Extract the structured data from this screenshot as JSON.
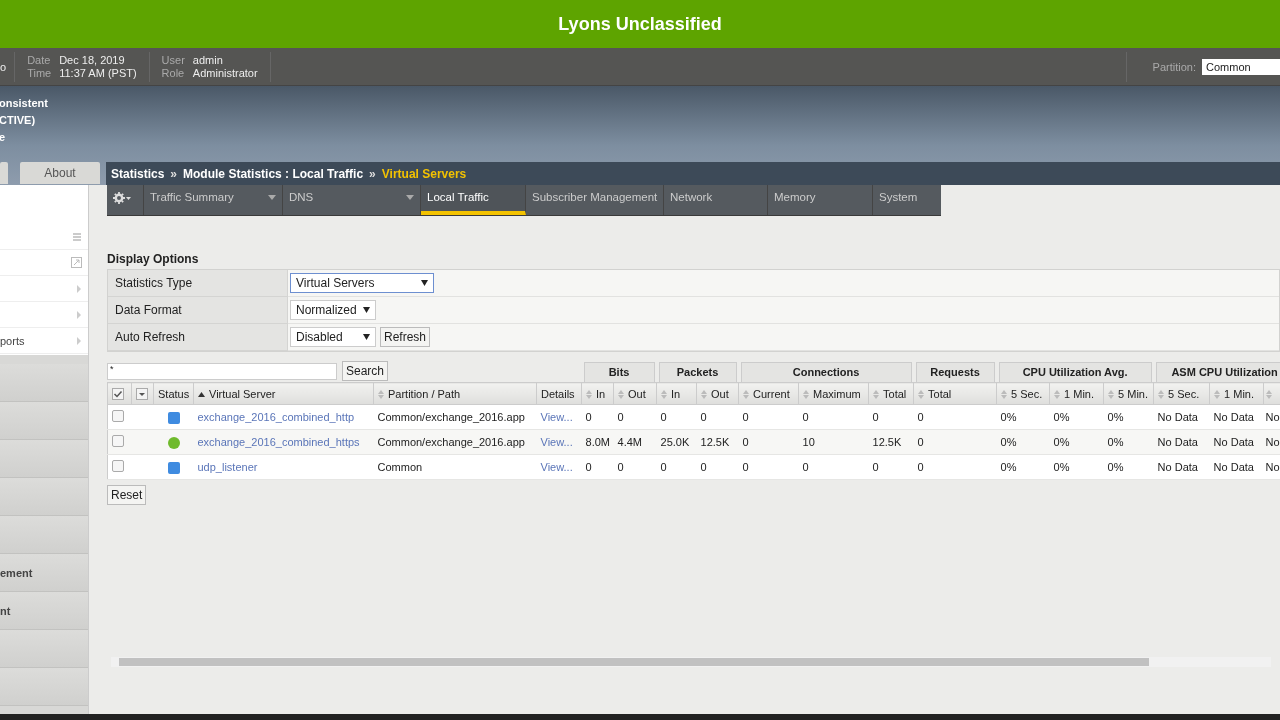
{
  "banner": {
    "title": "Lyons Unclassified"
  },
  "header": {
    "host_fragment": "o",
    "date_label": "Date",
    "date": "Dec 18, 2019",
    "time_label": "Time",
    "time": "11:37 AM (PST)",
    "user_label": "User",
    "user": "admin",
    "role_label": "Role",
    "role": "Administrator",
    "partition_label": "Partition:",
    "partition": "Common"
  },
  "status_lines": [
    "onsistent",
    "CTIVE)",
    "e"
  ],
  "top_tabs": [
    {
      "label": "About",
      "selected": false
    }
  ],
  "breadcrumb": {
    "separator": "»",
    "items": [
      {
        "text": "Statistics",
        "current": false
      },
      {
        "text": "Module Statistics : Local Traffic",
        "current": false
      },
      {
        "text": "Virtual Servers",
        "current": true
      }
    ]
  },
  "menu": {
    "items": [
      {
        "label": "Traffic Summary",
        "dropdown": true,
        "selected": false
      },
      {
        "label": "DNS",
        "dropdown": true,
        "selected": false
      },
      {
        "label": "Local Traffic",
        "dropdown": false,
        "selected": true
      },
      {
        "label": "Subscriber Management",
        "dropdown": false,
        "selected": false
      },
      {
        "label": "Network",
        "dropdown": false,
        "selected": false
      },
      {
        "label": "Memory",
        "dropdown": false,
        "selected": false
      },
      {
        "label": "System",
        "dropdown": false,
        "selected": false
      }
    ]
  },
  "sidebar": {
    "links": [
      {
        "kind": "list"
      },
      {
        "kind": "popout"
      },
      {
        "kind": "submenu"
      },
      {
        "kind": "submenu"
      },
      {
        "kind": "submenu",
        "label": "ports"
      }
    ],
    "modules": [
      {
        "label": "ement"
      },
      {
        "label": "nt"
      }
    ]
  },
  "display_options": {
    "title": "Display Options",
    "rows": [
      {
        "label": "Statistics Type",
        "value": "Virtual Servers",
        "focused": true
      },
      {
        "label": "Data Format",
        "value": "Normalized",
        "focused": false
      },
      {
        "label": "Auto Refresh",
        "value": "Disabled",
        "focused": false,
        "button": "Refresh"
      }
    ]
  },
  "search": {
    "value": "*",
    "button": "Search"
  },
  "table": {
    "group_headers": [
      {
        "label": "Bits"
      },
      {
        "label": "Packets"
      },
      {
        "label": "Connections"
      },
      {
        "label": "Requests"
      },
      {
        "label": "CPU Utilization Avg."
      },
      {
        "label": "ASM CPU Utilization"
      }
    ],
    "columns": [
      {
        "label": "Status",
        "sortable": false,
        "sorted": false
      },
      {
        "label": "Virtual Server",
        "sortable": true,
        "sorted": true
      },
      {
        "label": "Partition / Path",
        "sortable": true,
        "sorted": false
      },
      {
        "label": "Details",
        "sortable": false,
        "sorted": false
      },
      {
        "label": "In",
        "sortable": true,
        "sorted": false
      },
      {
        "label": "Out",
        "sortable": true,
        "sorted": false
      },
      {
        "label": "In",
        "sortable": true,
        "sorted": false
      },
      {
        "label": "Out",
        "sortable": true,
        "sorted": false
      },
      {
        "label": "Current",
        "sortable": true,
        "sorted": false
      },
      {
        "label": "Maximum",
        "sortable": true,
        "sorted": false
      },
      {
        "label": "Total",
        "sortable": true,
        "sorted": false
      },
      {
        "label": "Total",
        "sortable": true,
        "sorted": false
      },
      {
        "label": "5 Sec.",
        "sortable": true,
        "sorted": false
      },
      {
        "label": "1 Min.",
        "sortable": true,
        "sorted": false
      },
      {
        "label": "5 Min.",
        "sortable": true,
        "sorted": false
      },
      {
        "label": "5 Sec.",
        "sortable": true,
        "sorted": false
      },
      {
        "label": "1 Min.",
        "sortable": true,
        "sorted": false
      },
      {
        "sortable": true,
        "sorted": false
      }
    ],
    "rows": [
      {
        "checked": false,
        "status_icon": {
          "kind": "square",
          "color": "#3f8be0"
        },
        "name": "exchange_2016_combined_http",
        "path": "Common/exchange_2016.app",
        "details": "View...",
        "values": [
          "0",
          "0",
          "0",
          "0",
          "0",
          "0",
          "0",
          "0",
          "0%",
          "0%",
          "0%",
          "No Data",
          "No Data",
          "No"
        ]
      },
      {
        "checked": false,
        "status_icon": {
          "kind": "circle",
          "color": "#6fba2c"
        },
        "name": "exchange_2016_combined_https",
        "path": "Common/exchange_2016.app",
        "details": "View...",
        "values": [
          "8.0M",
          "4.4M",
          "25.0K",
          "12.5K",
          "0",
          "10",
          "12.5K",
          "0",
          "0%",
          "0%",
          "0%",
          "No Data",
          "No Data",
          "No"
        ]
      },
      {
        "checked": false,
        "status_icon": {
          "kind": "square",
          "color": "#3f8be0"
        },
        "name": "udp_listener",
        "path": "Common",
        "details": "View...",
        "values": [
          "0",
          "0",
          "0",
          "0",
          "0",
          "0",
          "0",
          "0",
          "0%",
          "0%",
          "0%",
          "No Data",
          "No Data",
          "No"
        ]
      }
    ],
    "reset": "Reset"
  }
}
